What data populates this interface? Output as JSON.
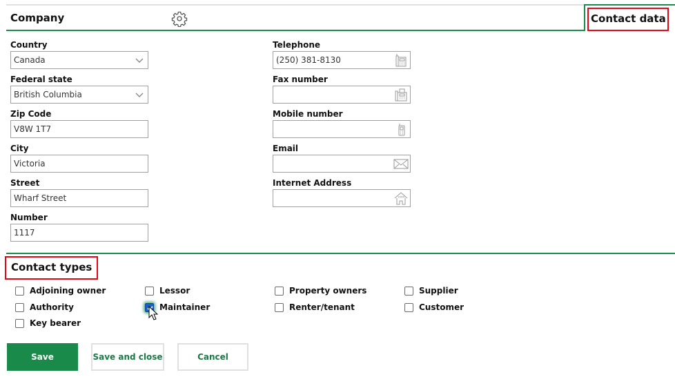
{
  "header": {
    "company_title": "Company",
    "settings_icon": "gear-icon",
    "contact_data_tab": "Contact data"
  },
  "address": {
    "country": {
      "label": "Country",
      "value": "Canada",
      "icon": "chevron-down-icon"
    },
    "federal_state": {
      "label": "Federal state",
      "value": "British Columbia",
      "icon": "chevron-down-icon"
    },
    "zip_code": {
      "label": "Zip Code",
      "value": "V8W 1T7"
    },
    "city": {
      "label": "City",
      "value": "Victoria"
    },
    "street": {
      "label": "Street",
      "value": "Wharf Street"
    },
    "number": {
      "label": "Number",
      "value": "1117"
    }
  },
  "contact": {
    "telephone": {
      "label": "Telephone",
      "value": "(250) 381-8130",
      "icon": "telephone-icon"
    },
    "fax": {
      "label": "Fax number",
      "value": "",
      "icon": "fax-icon"
    },
    "mobile": {
      "label": "Mobile number",
      "value": "",
      "icon": "mobile-phone-icon"
    },
    "email": {
      "label": "Email",
      "value": "",
      "icon": "envelope-icon"
    },
    "internet": {
      "label": "Internet Address",
      "value": "",
      "icon": "www-home-icon"
    }
  },
  "contact_types": {
    "title": "Contact types",
    "items": [
      {
        "label": "Adjoining owner",
        "checked": false
      },
      {
        "label": "Authority",
        "checked": false
      },
      {
        "label": "Key bearer",
        "checked": false
      },
      {
        "label": "Lessor",
        "checked": false
      },
      {
        "label": "Maintainer",
        "checked": true
      },
      {
        "label": "Property owners",
        "checked": false
      },
      {
        "label": "Renter/tenant",
        "checked": false
      },
      {
        "label": "Supplier",
        "checked": false
      },
      {
        "label": "Customer",
        "checked": false
      }
    ]
  },
  "buttons": {
    "save": "Save",
    "save_and_close": "Save and close",
    "cancel": "Cancel"
  },
  "colors": {
    "accent_green": "#1a8a4a",
    "highlight_red": "#e30613",
    "checkbox_blue": "#1565c0"
  }
}
